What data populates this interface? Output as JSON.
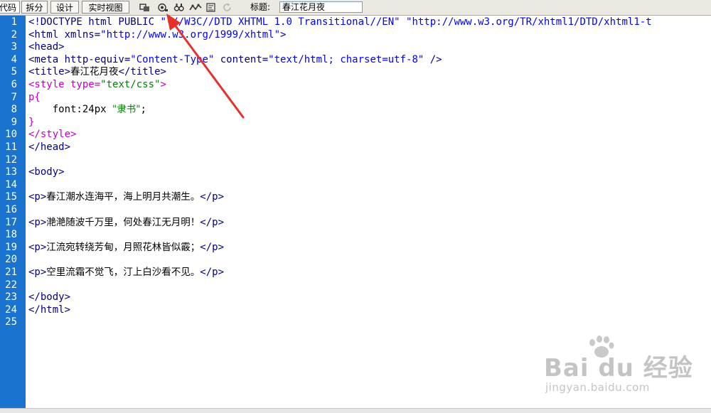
{
  "toolbar": {
    "view_buttons": [
      "代码",
      "拆分",
      "设计",
      "实时视图"
    ],
    "title_label": "标题:",
    "title_value": "春江花月夜"
  },
  "editor": {
    "line_numbers": [
      "1",
      "2",
      "3",
      "4",
      "5",
      "6",
      "7",
      "8",
      "9",
      "10",
      "11",
      "12",
      "13",
      "14",
      "15",
      "16",
      "17",
      "18",
      "19",
      "20",
      "21",
      "22",
      "23",
      "24",
      "25"
    ],
    "lines": {
      "l1a": "<!DOCTYPE html PUBLIC",
      "l1b": " \"-//W3C//DTD XHTML 1.0 Transitional//EN\" \"http://www.w3.org/TR/xhtml1/DTD/xhtml1-t",
      "l2a": "<html xmlns=",
      "l2b": "\"http://www.w3.org/1999/xhtml\"",
      "l2c": ">",
      "l3": "<head>",
      "l4a": "<meta http-equiv=",
      "l4b": "\"Content-Type\"",
      "l4c": " content=",
      "l4d": "\"text/html; charset=utf-8\"",
      "l4e": " />",
      "l5a": "<title>",
      "l5b": "春江花月夜",
      "l5c": "</title>",
      "l6a": "<style type=",
      "l6b": "\"text/css\"",
      "l6c": ">",
      "l7": "p{",
      "l8a": "    font:24px ",
      "l8b": "\"隶书\"",
      "l8c": ";",
      "l9": "}",
      "l10": "</style>",
      "l11": "</head>",
      "l13": "<body>",
      "l15a": "<p>",
      "l15b": "春江潮水连海平，海上明月共潮生。",
      "l15c": "</p>",
      "l17a": "<p>",
      "l17b": "滟滟随波千万里，何处春江无月明！",
      "l17c": "</p>",
      "l19a": "<p>",
      "l19b": "江流宛转绕芳甸，月照花林皆似霰；",
      "l19c": "</p>",
      "l21a": "<p>",
      "l21b": "空里流霜不觉飞，汀上白沙看不见。",
      "l21c": "</p>",
      "l23": "</body>",
      "l24": "</html>"
    }
  },
  "watermark": {
    "brand": "Bai du 经验",
    "url": "jingyan.baidu.com"
  },
  "colors": {
    "gutter": "#1b73d0",
    "tag": "#000080",
    "string": "#0000ff",
    "css": "#c000c0",
    "css_value": "#008000",
    "arrow": "#e8302a"
  },
  "icons": [
    "inspect-icon",
    "live-code-icon",
    "browser-preview-icon",
    "debug-icon",
    "visual-aids-icon",
    "refresh-icon"
  ]
}
